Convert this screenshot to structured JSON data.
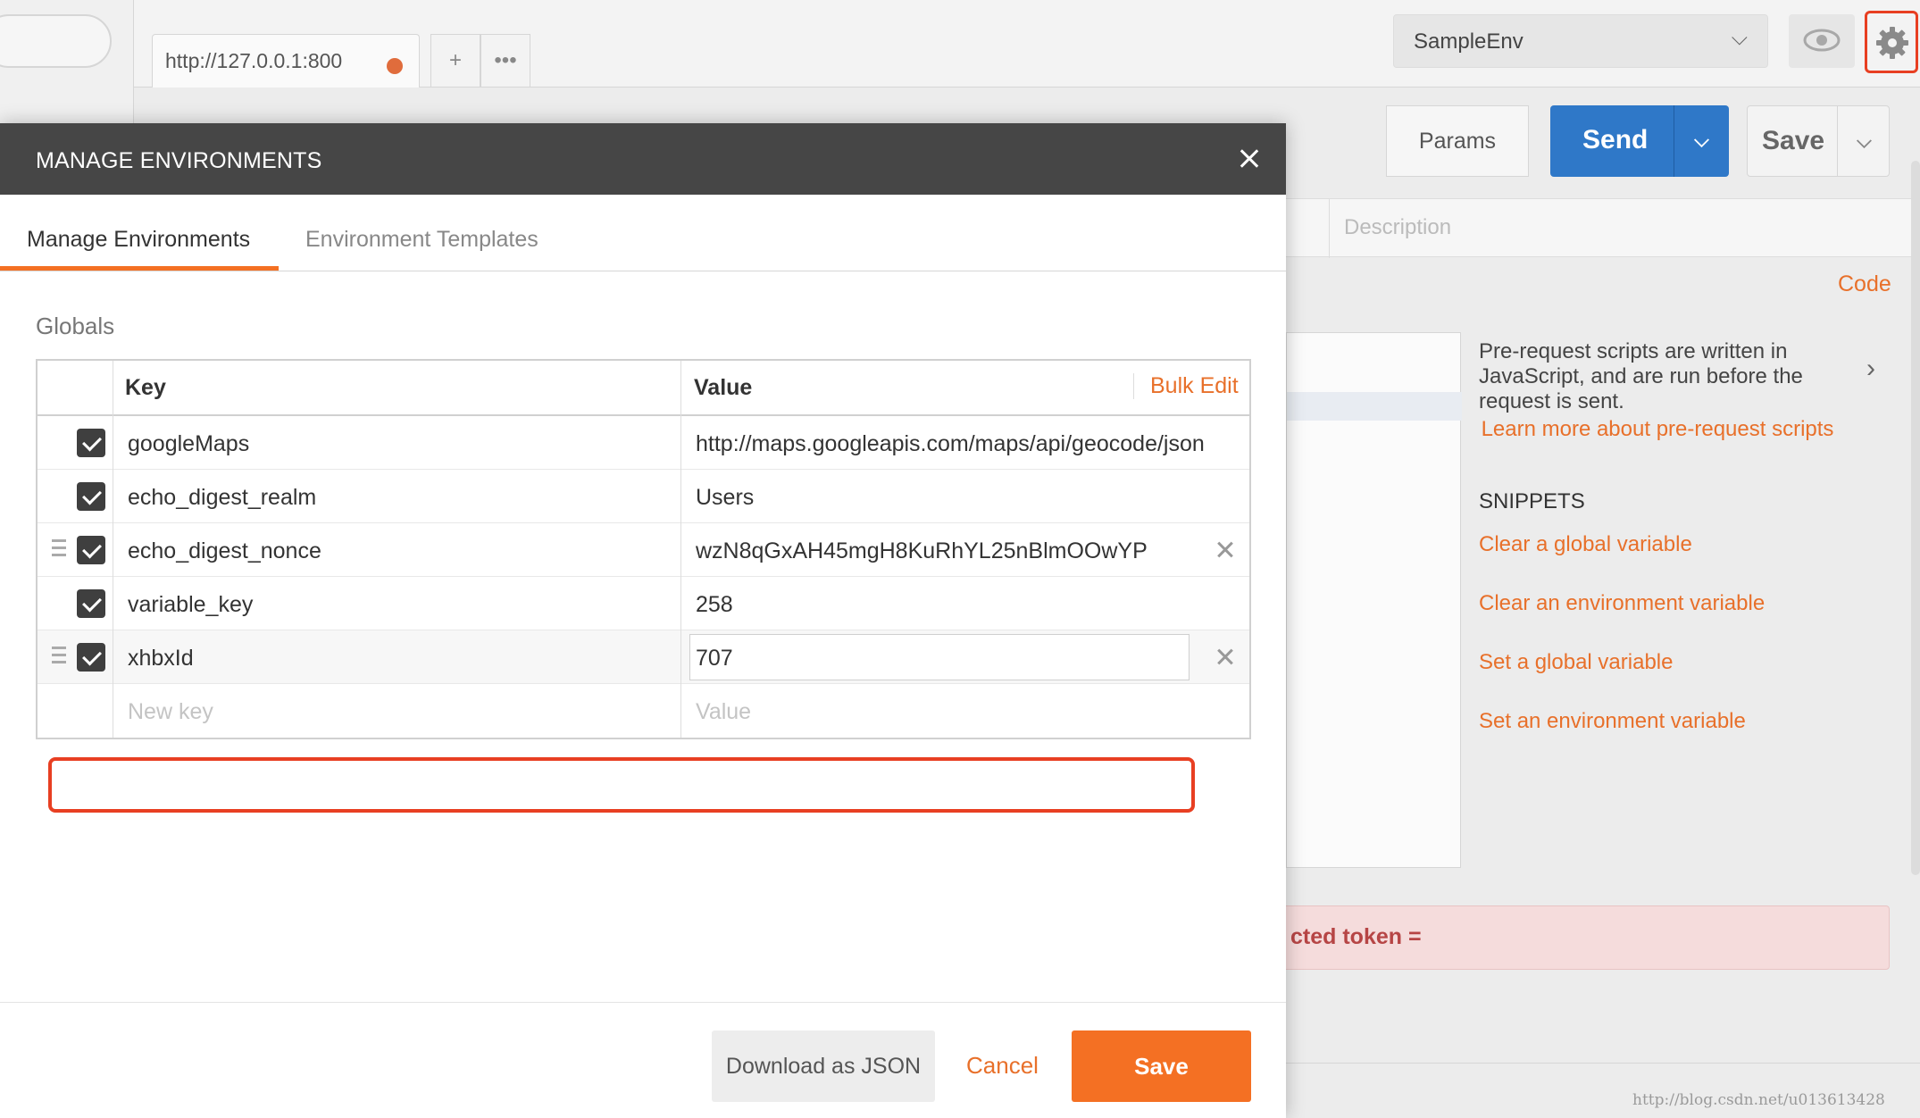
{
  "app": {
    "request_tab": "http://127.0.0.1:800",
    "env_selected": "SampleEnv",
    "params_label": "Params",
    "send_label": "Send",
    "save_label": "Save",
    "description_placeholder": "Description",
    "code_link": "Code",
    "info_text": "Pre-request scripts are written in JavaScript, and are run before the request is sent.",
    "learn_more": "Learn more about pre-request scripts",
    "snippets_heading": "SNIPPETS",
    "snippets": [
      "Clear a global variable",
      "Clear an environment variable",
      "Set a global variable",
      "Set an environment variable"
    ],
    "token_banner": "cted token =",
    "accent_color": "#f47023",
    "send_color": "#2f78c8"
  },
  "modal": {
    "title": "MANAGE ENVIRONMENTS",
    "tabs": [
      "Manage Environments",
      "Environment Templates"
    ],
    "globals_label": "Globals",
    "table": {
      "key_header": "Key",
      "value_header": "Value",
      "bulk_edit": "Bulk Edit",
      "rows": [
        {
          "checked": true,
          "key": "googleMaps",
          "value": "http://maps.googleapis.com/maps/api/geocode/json"
        },
        {
          "checked": true,
          "key": "echo_digest_realm",
          "value": "Users"
        },
        {
          "checked": true,
          "key": "echo_digest_nonce",
          "value": "wzN8qGxAH45mgH8KuRhYL25nBlmOOwYP"
        },
        {
          "checked": true,
          "key": "variable_key",
          "value": "258"
        },
        {
          "checked": true,
          "key": "xhbxId",
          "value": "707"
        }
      ],
      "new_key_placeholder": "New key",
      "new_value_placeholder": "Value"
    },
    "download_json": "Download as JSON",
    "cancel": "Cancel",
    "save": "Save"
  },
  "watermark": "http://blog.csdn.net/u013613428"
}
